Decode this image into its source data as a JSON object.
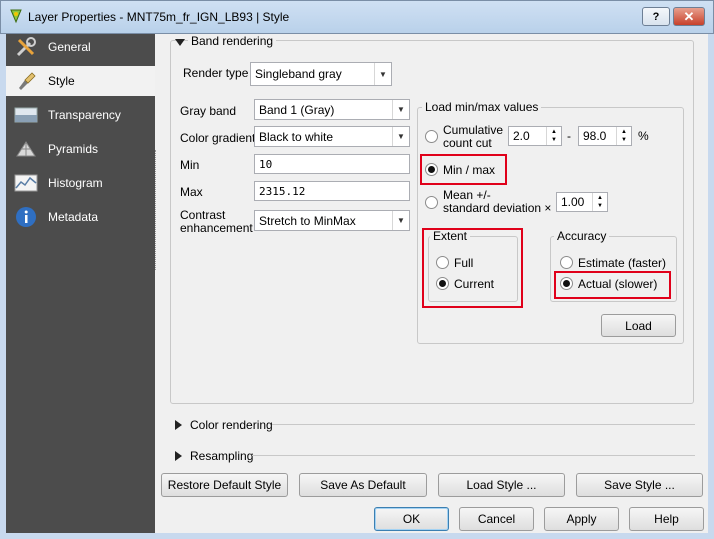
{
  "window": {
    "title": "Layer Properties - MNT75m_fr_IGN_LB93 | Style",
    "help_glyph": "?",
    "close_glyph": "✕"
  },
  "sidebar": {
    "items": [
      {
        "label": "General",
        "icon": "wrench-screwdriver-icon"
      },
      {
        "label": "Style",
        "icon": "paintbrush-icon",
        "active": true
      },
      {
        "label": "Transparency",
        "icon": "transparency-icon"
      },
      {
        "label": "Pyramids",
        "icon": "pyramid-icon"
      },
      {
        "label": "Histogram",
        "icon": "histogram-icon"
      },
      {
        "label": "Metadata",
        "icon": "info-icon"
      }
    ]
  },
  "band_rendering": {
    "section_title": "Band rendering",
    "render_type_label": "Render type",
    "render_type_value": "Singleband gray",
    "gray_band_label": "Gray band",
    "gray_band_value": "Band 1 (Gray)",
    "color_gradient_label": "Color gradient",
    "color_gradient_value": "Black to white",
    "min_label": "Min",
    "min_value": "10",
    "max_label": "Max",
    "max_value": "2315.12",
    "contrast_label_line1": "Contrast",
    "contrast_label_line2": "enhancement",
    "contrast_value": "Stretch to MinMax"
  },
  "minmax": {
    "group_title": "Load min/max values",
    "cumulative_line1": "Cumulative",
    "cumulative_line2": "count cut",
    "cumulative_low": "2.0",
    "dash": "-",
    "cumulative_high": "98.0",
    "percent": "%",
    "minmax_option": "Min / max",
    "mean_line1": "Mean +/-",
    "mean_line2": "standard deviation ×",
    "stddev_value": "1.00",
    "selected": "Min / max",
    "extent": {
      "title": "Extent",
      "full": "Full",
      "current": "Current",
      "selected": "Current"
    },
    "accuracy": {
      "title": "Accuracy",
      "estimate": "Estimate (faster)",
      "actual": "Actual (slower)",
      "selected": "Actual (slower)"
    },
    "load_button": "Load"
  },
  "sections": {
    "color_rendering": "Color rendering",
    "resampling": "Resampling"
  },
  "style_buttons": {
    "restore_default": "Restore Default Style",
    "save_default": "Save As Default",
    "load_style": "Load Style ...",
    "save_style": "Save Style ..."
  },
  "dialog_buttons": {
    "ok": "OK",
    "cancel": "Cancel",
    "apply": "Apply",
    "help": "Help"
  },
  "colors": {
    "highlight": "#e0001a",
    "sidebar_bg": "#4c4c4c"
  }
}
